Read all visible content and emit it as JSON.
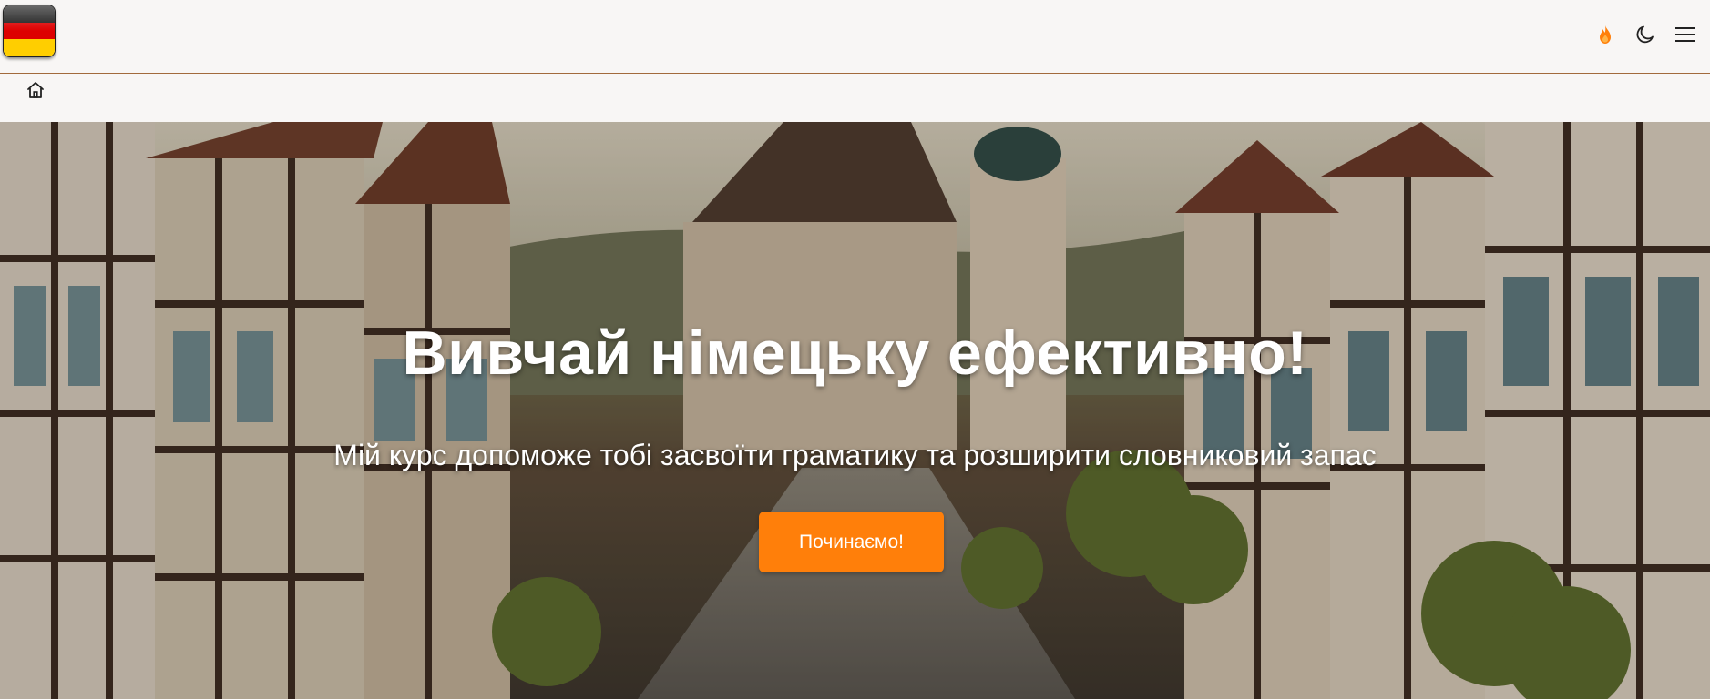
{
  "header": {
    "logo_icon": "germany-flag-icon",
    "flag_colors": [
      "#000000",
      "#dd0000",
      "#ffce00"
    ],
    "actions": [
      {
        "name": "streak-fire-icon",
        "color": "#ff7f0a"
      },
      {
        "name": "moon-icon",
        "color": "#222222"
      },
      {
        "name": "hamburger-menu-icon",
        "color": "#222222"
      }
    ]
  },
  "breadcrumb": {
    "home_icon": "home-icon"
  },
  "hero": {
    "title": "Вивчай німецьку ефективно!",
    "subtitle": "Мій курс допоможе тобі засвоїти граматику та розширити словниковий запас",
    "cta_label": "Починаємо!",
    "cta_color": "#ff7f0a"
  }
}
